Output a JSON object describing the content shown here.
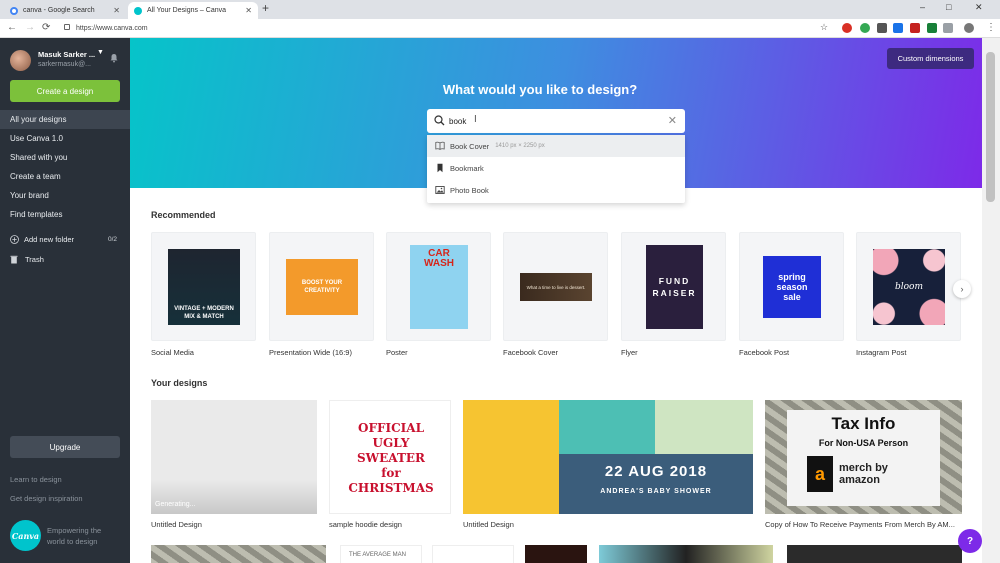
{
  "browser": {
    "tabs": [
      {
        "title": "canva - Google Search",
        "favicon_color": "#4285f4"
      },
      {
        "title": "All Your Designs – Canva",
        "favicon_color": "#00c4cc"
      }
    ],
    "new_tab_icon": "plus-icon",
    "window_controls": {
      "minimize": "–",
      "maximize": "□",
      "close": "✕"
    },
    "url": "https://www.canva.com"
  },
  "sidebar": {
    "user_name": "Masuk Sarker ...",
    "user_email": "sarkermasuk@...",
    "create_button": "Create a design",
    "nav_items": [
      {
        "label": "All your designs",
        "active": true
      },
      {
        "label": "Use Canva 1.0"
      },
      {
        "label": "Shared with you"
      },
      {
        "label": "Create a team"
      },
      {
        "label": "Your brand"
      },
      {
        "label": "Find templates"
      }
    ],
    "add_folder_label": "Add new folder",
    "folder_count": "0/2",
    "trash_label": "Trash",
    "upgrade_label": "Upgrade",
    "learn_link": "Learn to design",
    "inspiration_link": "Get design inspiration",
    "logo_text": "Canva",
    "tagline": "Empowering the world to design"
  },
  "hero": {
    "custom_dimensions": "Custom dimensions",
    "title": "What would you like to design?",
    "search_value": "book",
    "suggestions": [
      {
        "label": "Book Cover",
        "size": "1410 px × 2250 px",
        "icon": "book-icon"
      },
      {
        "label": "Bookmark",
        "size": "",
        "icon": "bookmark-icon"
      },
      {
        "label": "Photo Book",
        "size": "",
        "icon": "image-icon"
      }
    ]
  },
  "recommended": {
    "title": "Recommended",
    "items": [
      {
        "label": "Social Media",
        "thumb": "VINTAGE + MODERN MIX & MATCH"
      },
      {
        "label": "Presentation Wide (16:9)",
        "thumb": "BOOST YOUR CREATIVITY"
      },
      {
        "label": "Poster",
        "thumb": "CAR WASH"
      },
      {
        "label": "Facebook Cover",
        "thumb": "What a time to live is dessert."
      },
      {
        "label": "Flyer",
        "thumb": "FUND RAISER"
      },
      {
        "label": "Facebook Post",
        "thumb": "spring season sale"
      },
      {
        "label": "Instagram Post",
        "thumb": "bloom"
      }
    ]
  },
  "your_designs": {
    "title": "Your designs",
    "items": [
      {
        "label": "Untitled Design",
        "thumb": "Generating..."
      },
      {
        "label": "sample hoodie design",
        "thumb": "OFFICIAL UGLY SWEATER for CHRISTMAS"
      },
      {
        "label": "Untitled Design",
        "thumb": "22 AUG 2018",
        "sub": "ANDREA'S BABY SHOWER"
      },
      {
        "label": "Copy of How To Receive Payments From Merch By AM...",
        "thumb": "Tax Info",
        "sub": "For Non-USA Person",
        "brand": "merch by amazon"
      }
    ],
    "row2_texts": [
      "THE AVERAGE MAN"
    ]
  },
  "help_label": "?"
}
